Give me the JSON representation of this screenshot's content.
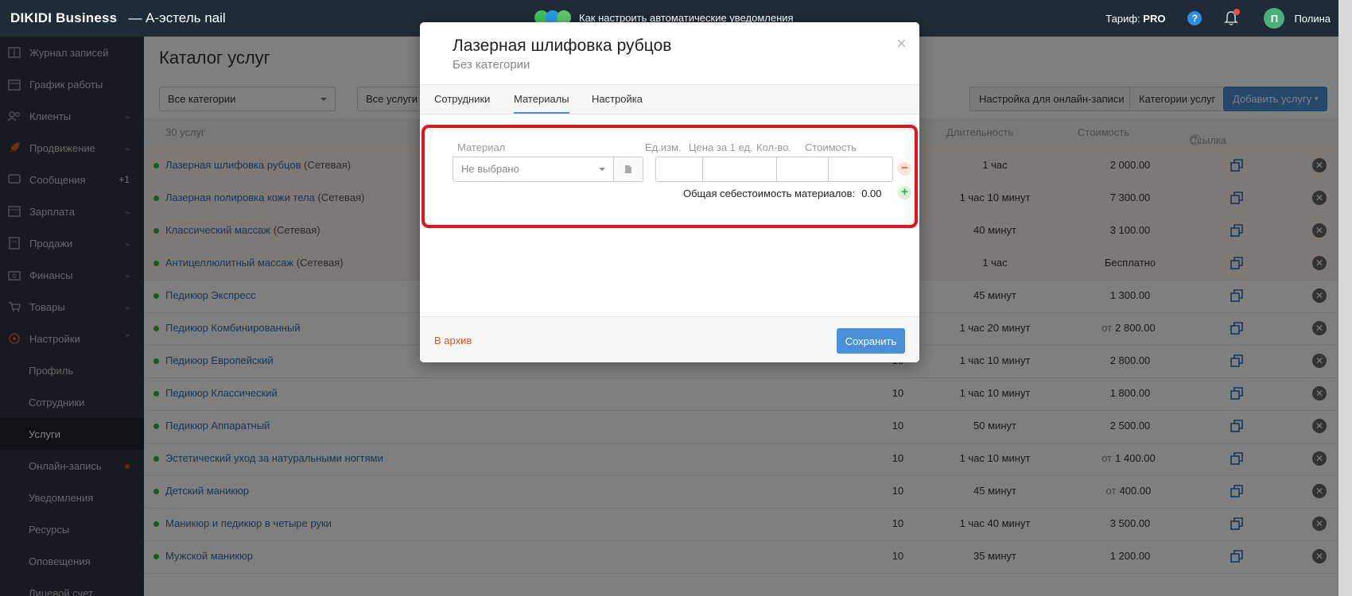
{
  "topbar": {
    "brand": "DIKIDI Business",
    "company": "—  А-эстель nail",
    "notice": "Как настроить автоматические уведомления",
    "tariff_label": "Тариф:",
    "tariff_value": "PRO",
    "help": "?",
    "avatar_letter": "П",
    "username": "Полина"
  },
  "sidebar": {
    "items": [
      {
        "label": "Журнал записей",
        "icon": "journal-icon"
      },
      {
        "label": "График работы",
        "icon": "calendar-icon"
      },
      {
        "label": "Клиенты",
        "icon": "users-icon",
        "chevron": true
      },
      {
        "label": "Продвижение",
        "icon": "rocket-icon",
        "chevron": true
      },
      {
        "label": "Сообщения",
        "icon": "message-icon",
        "count": "+1"
      },
      {
        "label": "Зарплата",
        "icon": "salary-icon",
        "chevron": true
      },
      {
        "label": "Продажи",
        "icon": "sales-icon",
        "chevron": true
      },
      {
        "label": "Финансы",
        "icon": "finance-icon",
        "chevron": true
      },
      {
        "label": "Товары",
        "icon": "cart-icon",
        "chevron": true
      },
      {
        "label": "Настройки",
        "icon": "settings-icon",
        "chevron_up": true
      }
    ],
    "sub_items": [
      "Профиль",
      "Сотрудники",
      "Услуги",
      "Онлайн-запись",
      "Уведомления",
      "Ресурсы",
      "Оповещения",
      "Лицевой счет"
    ]
  },
  "main": {
    "title": "Каталог услуг",
    "filter_categories": "Все категории",
    "filter_services": "Все услуги",
    "btn_online": "Настройка для онлайн-записи",
    "btn_categories": "Категории услуг",
    "btn_add": "Добавить услугу",
    "head_count": "30 услуг",
    "head_duration": "Длительность",
    "head_price": "Стоимость",
    "head_link": "Ссылка на запись",
    "network_tag": "(Сетевая)",
    "rows": [
      {
        "name": "Лазерная шлифовка рубцов",
        "net": true,
        "emp": "",
        "dur": "1 час",
        "from": "",
        "price": "2 000.00"
      },
      {
        "name": "Лазерная полировка кожи тела",
        "net": true,
        "emp": "",
        "dur": "1 час 10 минут",
        "from": "",
        "price": "7 300.00"
      },
      {
        "name": "Классический массаж",
        "net": true,
        "emp": "",
        "dur": "40 минут",
        "from": "",
        "price": "3 100.00"
      },
      {
        "name": "Антицеллюлитный массаж",
        "net": true,
        "emp": "",
        "dur": "1 час",
        "from": "",
        "price": "Бесплатно"
      },
      {
        "name": "Педикюр Экспресс",
        "net": false,
        "emp": "",
        "dur": "45 минут",
        "from": "",
        "price": "1 300.00"
      },
      {
        "name": "Педикюр Комбинированный",
        "net": false,
        "emp": "",
        "dur": "1 час 20 минут",
        "from": "от",
        "price": "2 800.00"
      },
      {
        "name": "Педикюр Европейский",
        "net": false,
        "emp": "10",
        "dur": "1 час 10 минут",
        "from": "",
        "price": "2 800.00"
      },
      {
        "name": "Педикюр Классический",
        "net": false,
        "emp": "10",
        "dur": "1 час 10 минут",
        "from": "",
        "price": "1 800.00"
      },
      {
        "name": "Педикюр Аппаратный",
        "net": false,
        "emp": "10",
        "dur": "50 минут",
        "from": "",
        "price": "2 500.00"
      },
      {
        "name": "Эстетический уход за натуральными ногтями",
        "net": false,
        "emp": "10",
        "dur": "1 час 10 минут",
        "from": "от",
        "price": "1 400.00"
      },
      {
        "name": "Детский маникюр",
        "net": false,
        "emp": "10",
        "dur": "45 минут",
        "from": "от",
        "price": "400.00"
      },
      {
        "name": "Маникюр и педикюр в четыре руки",
        "net": false,
        "emp": "10",
        "dur": "1 час 40 минут",
        "from": "",
        "price": "3 500.00"
      },
      {
        "name": "Мужской маникюр",
        "net": false,
        "emp": "10",
        "dur": "35 минут",
        "from": "",
        "price": "1 200.00"
      }
    ]
  },
  "modal": {
    "title": "Лазерная шлифовка рубцов",
    "subtitle": "Без категории",
    "close": "×",
    "tabs": [
      "Сотрудники",
      "Материалы",
      "Настройка"
    ],
    "active_tab": "Материалы",
    "col_material": "Материал",
    "col_unit": "Ед.изм.",
    "col_price": "Цена за 1 ед.",
    "col_qty": "Кол-во.",
    "col_cost": "Стоимость",
    "material_placeholder": "Не выбрано",
    "total_label": "Общая себестоимость материалов:",
    "total_value": "0.00",
    "archive": "В архив",
    "save": "Сохранить"
  },
  "colors": {
    "accent": "#4a90d9",
    "highlight": "#e8121e",
    "network_row": "#fdf0ee",
    "status_green": "#35b24a"
  }
}
